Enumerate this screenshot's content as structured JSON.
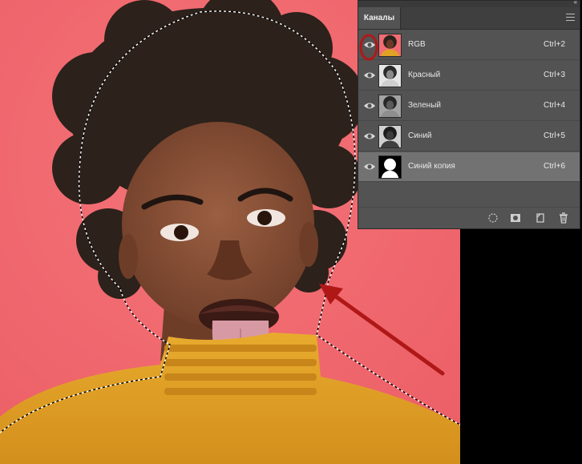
{
  "panel": {
    "collapse_glyph": "‹‹",
    "tab_label": "Каналы",
    "channels": [
      {
        "name": "RGB",
        "shortcut": "Ctrl+2",
        "visible": true,
        "selected": false,
        "thumb": "color"
      },
      {
        "name": "Красный",
        "shortcut": "Ctrl+3",
        "visible": true,
        "selected": false,
        "thumb": "gray-light"
      },
      {
        "name": "Зеленый",
        "shortcut": "Ctrl+4",
        "visible": true,
        "selected": false,
        "thumb": "gray"
      },
      {
        "name": "Синий",
        "shortcut": "Ctrl+5",
        "visible": true,
        "selected": false,
        "thumb": "gray-dark"
      },
      {
        "name": "Синий копия",
        "shortcut": "Ctrl+6",
        "visible": true,
        "selected": true,
        "thumb": "mask"
      }
    ],
    "footer_icons": [
      "load-selection-icon",
      "save-selection-icon",
      "new-channel-icon",
      "delete-icon"
    ]
  },
  "colors": {
    "canvas_background": "#f06a70",
    "sweater": "#e1a125",
    "skin": "#8a5238",
    "hair": "#2c211b",
    "annotation_red": "#b01818",
    "panel_bg": "#535353",
    "selected_row": "#727272"
  }
}
